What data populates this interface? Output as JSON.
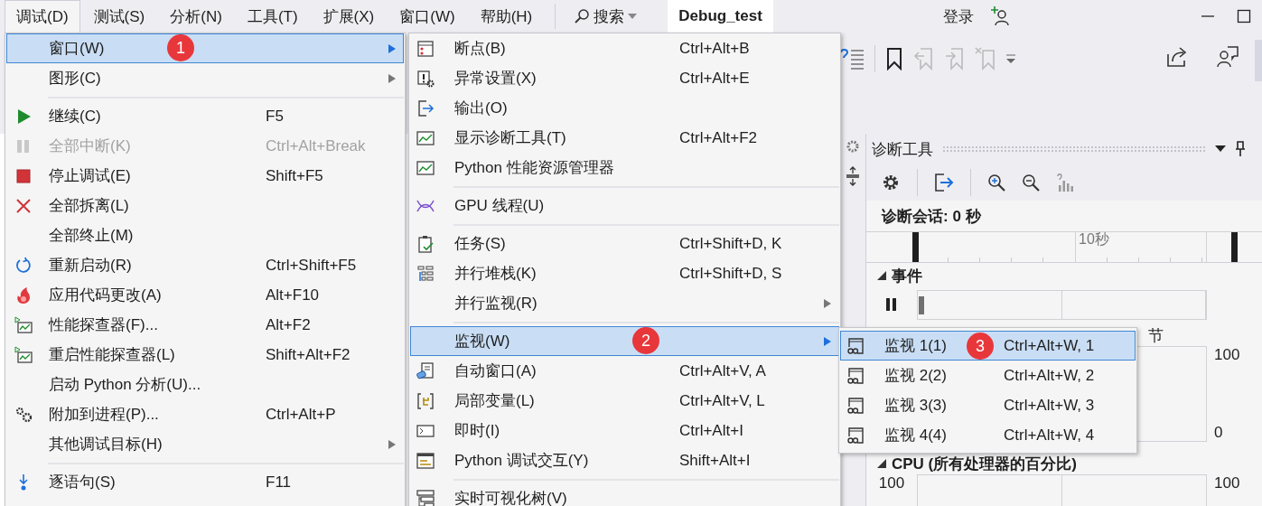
{
  "menu_bar": {
    "items": [
      {
        "label": "调试(D)",
        "selected": true
      },
      {
        "label": "测试(S)",
        "selected": false
      },
      {
        "label": "分析(N)",
        "selected": false
      },
      {
        "label": "工具(T)",
        "selected": false
      },
      {
        "label": "扩展(X)",
        "selected": false
      },
      {
        "label": "窗口(W)",
        "selected": false
      },
      {
        "label": "帮助(H)",
        "selected": false
      }
    ]
  },
  "search": {
    "label": "搜索"
  },
  "solution_name": "Debug_test",
  "sign_in": "登录",
  "debug_menu": {
    "items": [
      {
        "kind": "item",
        "label": "窗口(W)",
        "submenu": true,
        "selected": true,
        "disabled": false,
        "badge": "1"
      },
      {
        "kind": "item",
        "label": "图形(C)",
        "submenu": true,
        "selected": false,
        "disabled": false
      },
      {
        "kind": "separator"
      },
      {
        "kind": "item",
        "label": "继续(C)",
        "shortcut": "F5",
        "submenu": false,
        "selected": false,
        "disabled": false
      },
      {
        "kind": "item",
        "label": "全部中断(K)",
        "shortcut": "Ctrl+Alt+Break",
        "submenu": false,
        "selected": false,
        "disabled": true
      },
      {
        "kind": "item",
        "label": "停止调试(E)",
        "shortcut": "Shift+F5",
        "submenu": false,
        "selected": false,
        "disabled": false
      },
      {
        "kind": "item",
        "label": "全部拆离(L)",
        "submenu": false,
        "selected": false,
        "disabled": false
      },
      {
        "kind": "item",
        "label": "全部终止(M)",
        "submenu": false,
        "selected": false,
        "disabled": false
      },
      {
        "kind": "item",
        "label": "重新启动(R)",
        "shortcut": "Ctrl+Shift+F5",
        "submenu": false,
        "selected": false,
        "disabled": false
      },
      {
        "kind": "item",
        "label": "应用代码更改(A)",
        "shortcut": "Alt+F10",
        "submenu": false,
        "selected": false,
        "disabled": false
      },
      {
        "kind": "item",
        "label": "性能探查器(F)...",
        "shortcut": "Alt+F2",
        "submenu": false,
        "selected": false,
        "disabled": false
      },
      {
        "kind": "item",
        "label": "重启性能探查器(L)",
        "shortcut": "Shift+Alt+F2",
        "submenu": false,
        "selected": false,
        "disabled": false
      },
      {
        "kind": "item",
        "label": "启动 Python 分析(U)...",
        "submenu": false,
        "selected": false,
        "disabled": false
      },
      {
        "kind": "item",
        "label": "附加到进程(P)...",
        "shortcut": "Ctrl+Alt+P",
        "submenu": false,
        "selected": false,
        "disabled": false
      },
      {
        "kind": "item",
        "label": "其他调试目标(H)",
        "submenu": true,
        "selected": false,
        "disabled": false
      },
      {
        "kind": "separator"
      },
      {
        "kind": "item",
        "label": "逐语句(S)",
        "shortcut": "F11",
        "submenu": false,
        "selected": false,
        "disabled": false
      }
    ]
  },
  "window_submenu": {
    "items": [
      {
        "kind": "item",
        "label": "断点(B)",
        "shortcut": "Ctrl+Alt+B",
        "submenu": false,
        "selected": false
      },
      {
        "kind": "item",
        "label": "异常设置(X)",
        "shortcut": "Ctrl+Alt+E",
        "submenu": false,
        "selected": false
      },
      {
        "kind": "item",
        "label": "输出(O)",
        "submenu": false,
        "selected": false
      },
      {
        "kind": "item",
        "label": "显示诊断工具(T)",
        "shortcut": "Ctrl+Alt+F2",
        "submenu": false,
        "selected": false
      },
      {
        "kind": "item",
        "label": "Python 性能资源管理器",
        "submenu": false,
        "selected": false
      },
      {
        "kind": "separator"
      },
      {
        "kind": "item",
        "label": "GPU 线程(U)",
        "submenu": false,
        "selected": false
      },
      {
        "kind": "separator"
      },
      {
        "kind": "item",
        "label": "任务(S)",
        "shortcut": "Ctrl+Shift+D, K",
        "submenu": false,
        "selected": false
      },
      {
        "kind": "item",
        "label": "并行堆栈(K)",
        "shortcut": "Ctrl+Shift+D, S",
        "submenu": false,
        "selected": false
      },
      {
        "kind": "item",
        "label": "并行监视(R)",
        "submenu": true,
        "selected": false
      },
      {
        "kind": "separator"
      },
      {
        "kind": "item",
        "label": "监视(W)",
        "submenu": true,
        "selected": true,
        "badge": "2"
      },
      {
        "kind": "item",
        "label": "自动窗口(A)",
        "shortcut": "Ctrl+Alt+V, A",
        "submenu": false,
        "selected": false
      },
      {
        "kind": "item",
        "label": "局部变量(L)",
        "shortcut": "Ctrl+Alt+V, L",
        "submenu": false,
        "selected": false
      },
      {
        "kind": "item",
        "label": "即时(I)",
        "shortcut": "Ctrl+Alt+I",
        "submenu": false,
        "selected": false
      },
      {
        "kind": "item",
        "label": "Python 调试交互(Y)",
        "shortcut": "Shift+Alt+I",
        "submenu": false,
        "selected": false
      },
      {
        "kind": "separator"
      },
      {
        "kind": "item",
        "label": "实时可视化树(V)",
        "submenu": false,
        "selected": false
      }
    ]
  },
  "watch_submenu": {
    "items": [
      {
        "kind": "item",
        "label": "监视 1(1)",
        "shortcut": "Ctrl+Alt+W, 1",
        "selected": true,
        "badge": "3"
      },
      {
        "kind": "item",
        "label": "监视 2(2)",
        "shortcut": "Ctrl+Alt+W, 2",
        "selected": false
      },
      {
        "kind": "item",
        "label": "监视 3(3)",
        "shortcut": "Ctrl+Alt+W, 3",
        "selected": false
      },
      {
        "kind": "item",
        "label": "监视 4(4)",
        "shortcut": "Ctrl+Alt+W, 4",
        "selected": false
      }
    ]
  },
  "diagnostic_tools": {
    "title": "诊断工具",
    "session": "诊断会话: 0 秒",
    "timeline_label": "10秒",
    "events": {
      "title": "事件",
      "expanded": true
    },
    "legend_fragment": "节",
    "memory": {
      "max_label": "100",
      "min_label": "0"
    },
    "cpu": {
      "title": "CPU (所有处理器的百分比)",
      "expanded": true,
      "left_max": "100",
      "right_max": "100"
    }
  }
}
